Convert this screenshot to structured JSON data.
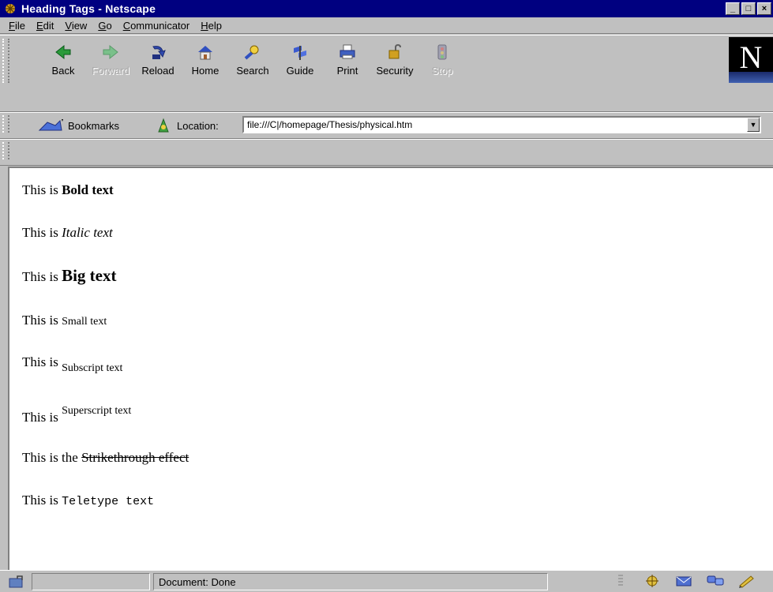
{
  "window": {
    "title": "Heading Tags - Netscape",
    "controls": {
      "minimize": "_",
      "maximize": "□",
      "close": "×"
    }
  },
  "menu": [
    "File",
    "Edit",
    "View",
    "Go",
    "Communicator",
    "Help"
  ],
  "menu_underlines": [
    "F",
    "E",
    "V",
    "G",
    "C",
    "H"
  ],
  "nav_buttons": [
    {
      "label": "Back",
      "icon": "back-arrow-icon",
      "enabled": true
    },
    {
      "label": "Forward",
      "icon": "forward-arrow-icon",
      "enabled": false
    },
    {
      "label": "Reload",
      "icon": "reload-icon",
      "enabled": true
    },
    {
      "label": "Home",
      "icon": "home-icon",
      "enabled": true
    },
    {
      "label": "Search",
      "icon": "search-icon",
      "enabled": true
    },
    {
      "label": "Guide",
      "icon": "guide-icon",
      "enabled": true
    },
    {
      "label": "Print",
      "icon": "print-icon",
      "enabled": true
    },
    {
      "label": "Security",
      "icon": "security-lock-icon",
      "enabled": true
    },
    {
      "label": "Stop",
      "icon": "stop-icon",
      "enabled": false
    }
  ],
  "logo": {
    "letter": "N"
  },
  "location_bar": {
    "bookmarks_label": "Bookmarks",
    "location_label": "Location:",
    "url": "file:///C|/homepage/Thesis/physical.htm"
  },
  "content": {
    "bold": {
      "prefix": "This is ",
      "styled": "Bold text"
    },
    "italic": {
      "prefix": "This is ",
      "styled": "Italic text"
    },
    "big": {
      "prefix": "This is ",
      "styled": "Big text"
    },
    "small": {
      "prefix": "This is ",
      "styled": "Small text"
    },
    "subscript": {
      "prefix": "This is ",
      "styled": "Subscript text"
    },
    "superscript": {
      "prefix": "This is ",
      "styled": "Superscript text"
    },
    "strike": {
      "prefix": "This is the ",
      "styled": "Strikethrough effect"
    },
    "teletype": {
      "prefix": "This is ",
      "styled": "Teletype text"
    }
  },
  "status": {
    "text": "Document: Done"
  },
  "colors": {
    "titlebar": "#000080",
    "chrome": "#c0c0c0",
    "content_bg": "#ffffff"
  }
}
